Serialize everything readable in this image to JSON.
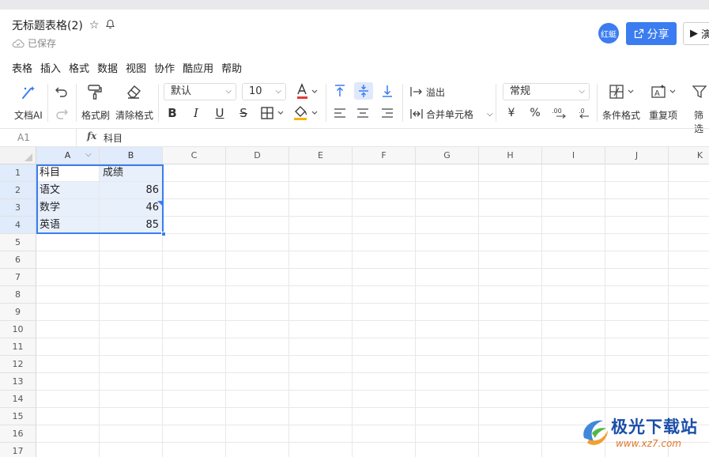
{
  "document": {
    "title": "无标题表格(2)",
    "save_status": "已保存"
  },
  "header": {
    "avatar_label": "红蜓",
    "share_label": "分享",
    "present_label": "演"
  },
  "menu": [
    "表格",
    "插入",
    "格式",
    "数据",
    "视图",
    "协作",
    "酷应用",
    "帮助"
  ],
  "toolbar": {
    "ai_label": "文档AI",
    "format_painter_label": "格式刷",
    "clear_format_label": "清除格式",
    "font_family": "默认",
    "font_size": "10",
    "overflow_label": "溢出",
    "merge_label": "合并单元格",
    "number_format": "常规",
    "currency_symbol": "¥",
    "percent_symbol": "%",
    "cond_format_label": "条件格式",
    "duplicate_label": "重复项",
    "filter_label": "筛选",
    "colors": {
      "accent": "#3b7cf0",
      "font_color": "#e53935",
      "fill_color": "#f5b400"
    }
  },
  "formula_bar": {
    "cell_ref": "A1",
    "fx_label": "fx",
    "value": "科目"
  },
  "sheet": {
    "columns": [
      "A",
      "B",
      "C",
      "D",
      "E",
      "F",
      "G",
      "H",
      "I",
      "J",
      "K"
    ],
    "rows": [
      "1",
      "2",
      "3",
      "4",
      "5",
      "6",
      "7",
      "8",
      "9",
      "10",
      "11",
      "12",
      "13",
      "14",
      "15",
      "16",
      "17"
    ],
    "cells": [
      {
        "a": "科目",
        "b": "成绩"
      },
      {
        "a": "语文",
        "b": "86"
      },
      {
        "a": "数学",
        "b": "46"
      },
      {
        "a": "英语",
        "b": "85"
      }
    ]
  },
  "watermark": {
    "title": "极光下载站",
    "url": "www.xz7.com"
  }
}
